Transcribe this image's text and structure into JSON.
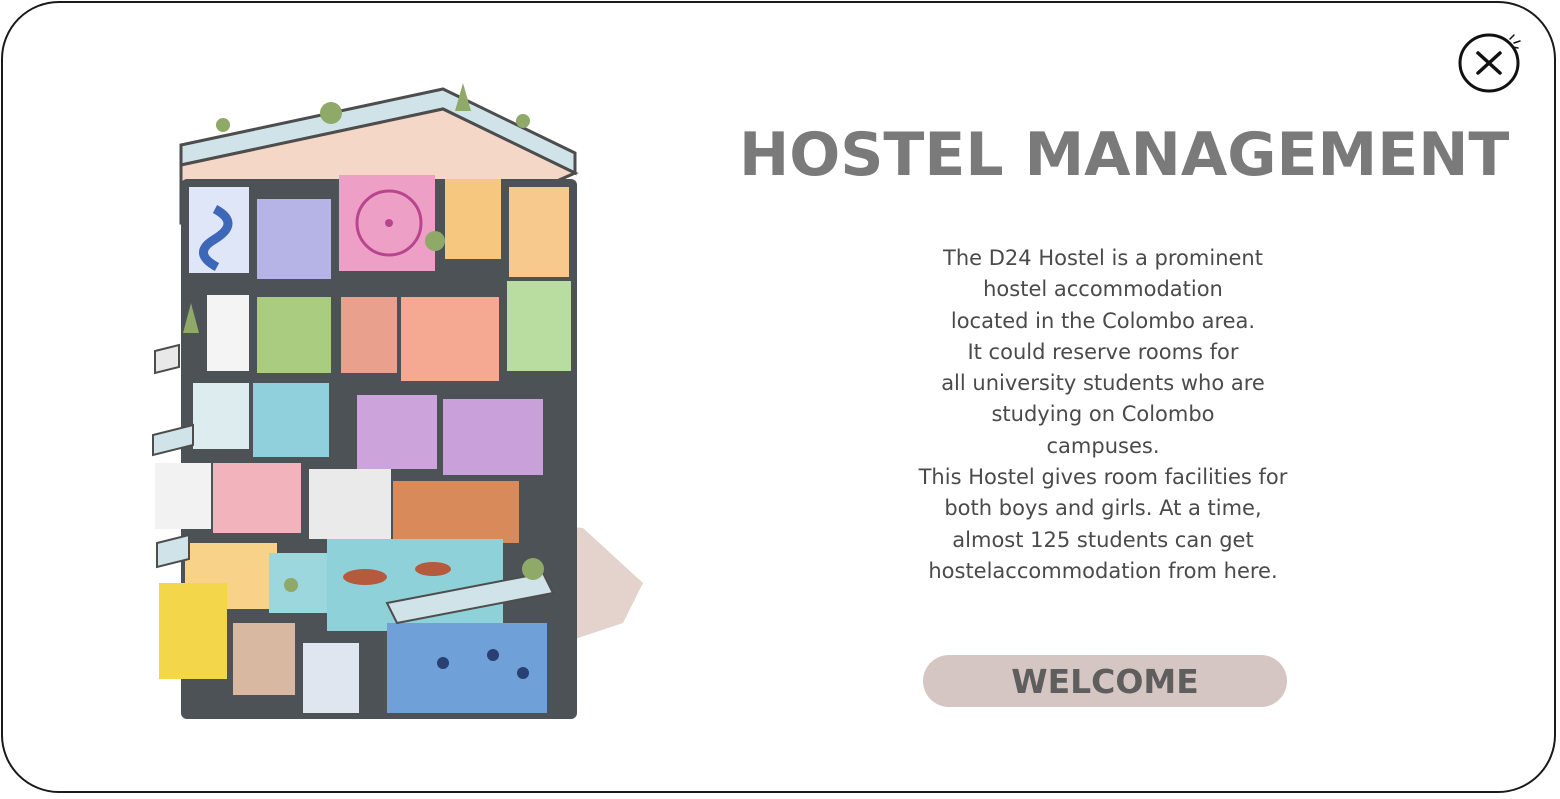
{
  "window": {
    "title": "HOSTEL MANAGEMENT",
    "description_lines": [
      "The D24 Hostel is a prominent",
      "hostel accommodation",
      " located in the Colombo area.",
      " It could reserve rooms for",
      "all university students who are",
      "studying on Colombo",
      "campuses.",
      "This Hostel gives room facilities for",
      "both boys and girls. At a time,",
      "almost 125 students can get",
      "hostelaccommodation from here."
    ],
    "welcome_label": "WELCOME",
    "close_icon": "close-icon",
    "illustration": "hostel-building-illustration"
  },
  "colors": {
    "title": "#7a7a7a",
    "text": "#4a4a4a",
    "button_bg": "#d6c6c3",
    "button_text": "#5e5e5e",
    "border": "#1a1a1a"
  }
}
